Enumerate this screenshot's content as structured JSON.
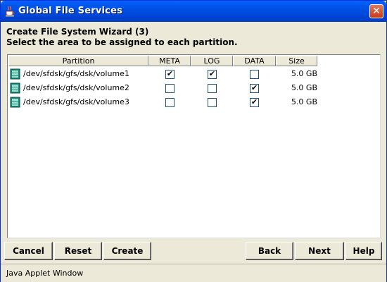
{
  "window": {
    "title": "Global File Services",
    "close_glyph": "✕"
  },
  "wizard": {
    "heading": "Create File System Wizard (3)",
    "instruction": "Select the area to be assigned to each partition."
  },
  "table": {
    "columns": [
      "Partition",
      "META",
      "LOG",
      "DATA",
      "Size"
    ],
    "rows": [
      {
        "partition": "/dev/sfdsk/gfs/dsk/volume1",
        "meta": "✔",
        "log": "✔",
        "data": "",
        "size": "5.0 GB"
      },
      {
        "partition": "/dev/sfdsk/gfs/dsk/volume2",
        "meta": "",
        "log": "",
        "data": "✔",
        "size": "5.0 GB"
      },
      {
        "partition": "/dev/sfdsk/gfs/dsk/volume3",
        "meta": "",
        "log": "",
        "data": "✔",
        "size": "5.0 GB"
      }
    ]
  },
  "buttons": {
    "cancel": "Cancel",
    "reset": "Reset",
    "create": "Create",
    "back": "Back",
    "next": "Next",
    "help": "Help"
  },
  "status": {
    "text": "Java Applet Window"
  },
  "colors": {
    "titlebar": "#0058ee",
    "face": "#ece9d8",
    "close": "#c8391a"
  },
  "icons": {
    "window": "java-cup-icon",
    "row": "disk-volume-icon",
    "close": "close-icon"
  }
}
